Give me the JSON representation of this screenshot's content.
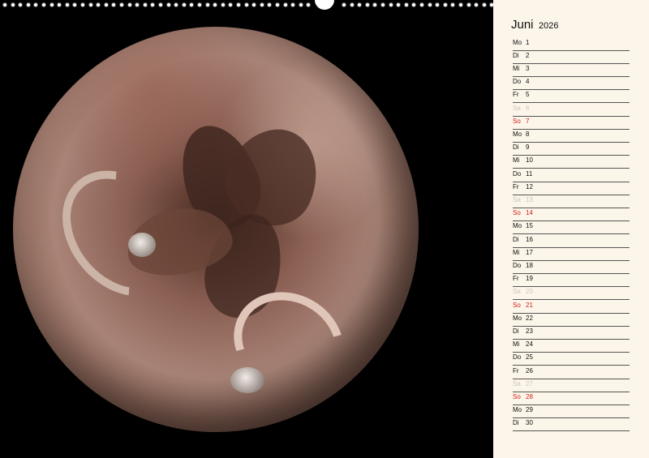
{
  "calendar": {
    "month": "Juni",
    "year": "2026",
    "days": [
      {
        "name": "Mo",
        "num": "1",
        "type": "weekday"
      },
      {
        "name": "Di",
        "num": "2",
        "type": "weekday"
      },
      {
        "name": "Mi",
        "num": "3",
        "type": "weekday"
      },
      {
        "name": "Do",
        "num": "4",
        "type": "weekday"
      },
      {
        "name": "Fr",
        "num": "5",
        "type": "weekday"
      },
      {
        "name": "Sa",
        "num": "6",
        "type": "sat"
      },
      {
        "name": "So",
        "num": "7",
        "type": "sun"
      },
      {
        "name": "Mo",
        "num": "8",
        "type": "weekday"
      },
      {
        "name": "Di",
        "num": "9",
        "type": "weekday"
      },
      {
        "name": "Mi",
        "num": "10",
        "type": "weekday"
      },
      {
        "name": "Do",
        "num": "11",
        "type": "weekday"
      },
      {
        "name": "Fr",
        "num": "12",
        "type": "weekday"
      },
      {
        "name": "Sa",
        "num": "13",
        "type": "sat"
      },
      {
        "name": "So",
        "num": "14",
        "type": "sun"
      },
      {
        "name": "Mo",
        "num": "15",
        "type": "weekday"
      },
      {
        "name": "Di",
        "num": "16",
        "type": "weekday"
      },
      {
        "name": "Mi",
        "num": "17",
        "type": "weekday"
      },
      {
        "name": "Do",
        "num": "18",
        "type": "weekday"
      },
      {
        "name": "Fr",
        "num": "19",
        "type": "weekday"
      },
      {
        "name": "Sa",
        "num": "20",
        "type": "sat"
      },
      {
        "name": "So",
        "num": "21",
        "type": "sun"
      },
      {
        "name": "Mo",
        "num": "22",
        "type": "weekday"
      },
      {
        "name": "Di",
        "num": "23",
        "type": "weekday"
      },
      {
        "name": "Mi",
        "num": "24",
        "type": "weekday"
      },
      {
        "name": "Do",
        "num": "25",
        "type": "weekday"
      },
      {
        "name": "Fr",
        "num": "26",
        "type": "weekday"
      },
      {
        "name": "Sa",
        "num": "27",
        "type": "sat"
      },
      {
        "name": "So",
        "num": "28",
        "type": "sun"
      },
      {
        "name": "Mo",
        "num": "29",
        "type": "weekday"
      },
      {
        "name": "Di",
        "num": "30",
        "type": "weekday"
      }
    ]
  },
  "colors": {
    "sunday": "#d21c1c",
    "saturday": "#cfc4bd",
    "panel_background": "#fcf5e9",
    "photo_background": "#000000"
  }
}
